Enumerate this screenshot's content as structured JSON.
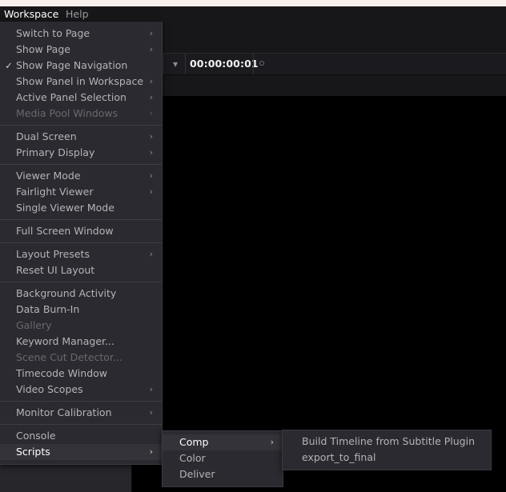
{
  "window": {
    "title_strip_color": "#f9f0ee",
    "background_color": "#000000"
  },
  "menubar": {
    "items": [
      {
        "label": "Workspace",
        "state": "active"
      },
      {
        "label": "Help",
        "state": "idle"
      }
    ]
  },
  "toolbar": {
    "timecode": "00:00:00:01",
    "chevron_icon": "chevron-down-icon",
    "record_dot_icon": "circle-outline-icon"
  },
  "workspace_menu": {
    "items": [
      {
        "label": "Switch to Page",
        "arrow": "›",
        "disabled": false,
        "checked": false
      },
      {
        "label": "Show Page",
        "arrow": "›",
        "disabled": false,
        "checked": false
      },
      {
        "label": "Show Page Navigation",
        "arrow": "",
        "disabled": false,
        "checked": true
      },
      {
        "label": "Show Panel in Workspace",
        "arrow": "›",
        "disabled": false,
        "checked": false
      },
      {
        "label": "Active Panel Selection",
        "arrow": "›",
        "disabled": false,
        "checked": false
      },
      {
        "label": "Media Pool Windows",
        "arrow": "›",
        "disabled": true,
        "checked": false
      },
      {
        "separator": true
      },
      {
        "label": "Dual Screen",
        "arrow": "›",
        "disabled": false,
        "checked": false
      },
      {
        "label": "Primary Display",
        "arrow": "›",
        "disabled": false,
        "checked": false
      },
      {
        "separator": true
      },
      {
        "label": "Viewer Mode",
        "arrow": "›",
        "disabled": false,
        "checked": false
      },
      {
        "label": "Fairlight Viewer",
        "arrow": "›",
        "disabled": false,
        "checked": false
      },
      {
        "label": "Single Viewer Mode",
        "arrow": "",
        "disabled": false,
        "checked": false
      },
      {
        "separator": true
      },
      {
        "label": "Full Screen Window",
        "arrow": "",
        "disabled": false,
        "checked": false
      },
      {
        "separator": true
      },
      {
        "label": "Layout Presets",
        "arrow": "›",
        "disabled": false,
        "checked": false
      },
      {
        "label": "Reset UI Layout",
        "arrow": "",
        "disabled": false,
        "checked": false
      },
      {
        "separator": true
      },
      {
        "label": "Background Activity",
        "arrow": "",
        "disabled": false,
        "checked": false
      },
      {
        "label": "Data Burn-In",
        "arrow": "",
        "disabled": false,
        "checked": false
      },
      {
        "label": "Gallery",
        "arrow": "",
        "disabled": true,
        "checked": false
      },
      {
        "label": "Keyword Manager...",
        "arrow": "",
        "disabled": false,
        "checked": false
      },
      {
        "label": "Scene Cut Detector...",
        "arrow": "",
        "disabled": true,
        "checked": false
      },
      {
        "label": "Timecode Window",
        "arrow": "",
        "disabled": false,
        "checked": false
      },
      {
        "label": "Video Scopes",
        "arrow": "›",
        "disabled": false,
        "checked": false
      },
      {
        "separator": true
      },
      {
        "label": "Monitor Calibration",
        "arrow": "›",
        "disabled": false,
        "checked": false
      },
      {
        "separator": true
      },
      {
        "label": "Console",
        "arrow": "",
        "disabled": false,
        "checked": false
      },
      {
        "label": "Scripts",
        "arrow": "›",
        "disabled": false,
        "checked": false,
        "selected": true
      }
    ]
  },
  "scripts_submenu": {
    "items": [
      {
        "label": "Comp",
        "arrow": "›",
        "selected": true
      },
      {
        "label": "Color",
        "arrow": "",
        "selected": false
      },
      {
        "label": "Deliver",
        "arrow": "",
        "selected": false
      }
    ]
  },
  "comp_submenu": {
    "items": [
      {
        "label": "Build Timeline from Subtitle Plugin"
      },
      {
        "label": "export_to_final"
      }
    ]
  }
}
